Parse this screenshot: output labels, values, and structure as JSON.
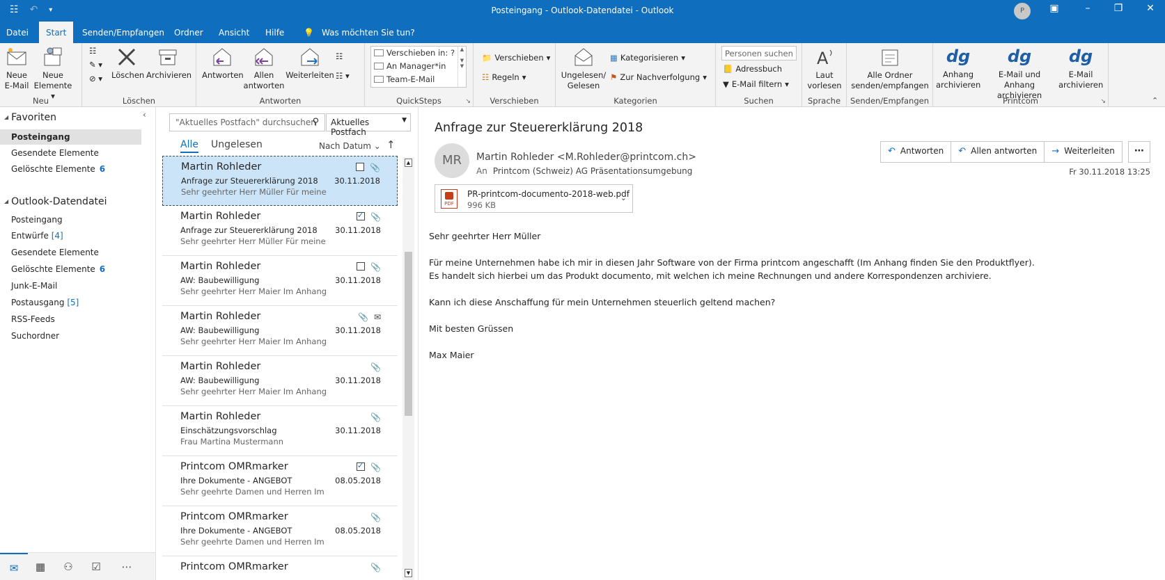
{
  "window": {
    "title": "Posteingang - Outlook-Datendatei  -  Outlook",
    "avatar_initial": "P"
  },
  "menu": {
    "tabs": [
      "Datei",
      "Start",
      "Senden/Empfangen",
      "Ordner",
      "Ansicht",
      "Hilfe"
    ],
    "active_tab": "Start",
    "tell_me": "Was möchten Sie tun?"
  },
  "ribbon": {
    "neu": {
      "label": "Neu",
      "new_email_1": "Neue",
      "new_email_2": "E-Mail",
      "new_items_1": "Neue",
      "new_items_2": "Elemente"
    },
    "loeschen": {
      "label": "Löschen",
      "delete": "Löschen",
      "archive": "Archivieren"
    },
    "antworten": {
      "label": "Antworten",
      "reply": "Antworten",
      "reply_all_1": "Allen",
      "reply_all_2": "antworten",
      "forward": "Weiterleiten"
    },
    "quicksteps": {
      "label": "QuickSteps",
      "items": [
        "Verschieben in: ?",
        "An Manager*in",
        "Team-E-Mail"
      ]
    },
    "verschieben": {
      "label": "Verschieben",
      "move": "Verschieben",
      "rules": "Regeln"
    },
    "kategorien": {
      "label": "Kategorien",
      "unread_1": "Ungelesen/",
      "unread_2": "Gelesen",
      "categorize": "Kategorisieren",
      "followup": "Zur Nachverfolgung"
    },
    "suchen": {
      "label": "Suchen",
      "people_placeholder": "Personen suchen",
      "addressbook": "Adressbuch",
      "filter": "E-Mail filtern"
    },
    "sprache": {
      "label": "Sprache",
      "read_aloud_1": "Laut",
      "read_aloud_2": "vorlesen"
    },
    "sendrecv": {
      "label": "Senden/Empfangen",
      "all_1": "Alle Ordner",
      "all_2": "senden/empfangen"
    },
    "printcom": {
      "label": "Printcom",
      "logo": "dg",
      "b1_1": "Anhang",
      "b1_2": "archivieren",
      "b2_1": "E-Mail und",
      "b2_2": "Anhang archivieren",
      "b3_1": "E-Mail",
      "b3_2": "archivieren"
    }
  },
  "folders": {
    "favorites_title": "Favoriten",
    "favorites": [
      {
        "name": "Posteingang",
        "count": ""
      },
      {
        "name": "Gesendete Elemente",
        "count": ""
      },
      {
        "name": "Gelöschte Elemente",
        "count": "6"
      }
    ],
    "datafile_title": "Outlook-Datendatei",
    "datafile": [
      {
        "name": "Posteingang",
        "count": ""
      },
      {
        "name": "Entwürfe",
        "bracket": "[4]"
      },
      {
        "name": "Gesendete Elemente",
        "count": ""
      },
      {
        "name": "Gelöschte Elemente",
        "count": "6"
      },
      {
        "name": "Junk-E-Mail",
        "count": ""
      },
      {
        "name": "Postausgang",
        "bracket": "[5]"
      },
      {
        "name": "RSS-Feeds",
        "count": ""
      },
      {
        "name": "Suchordner",
        "count": ""
      }
    ]
  },
  "list": {
    "search_placeholder": "\"Aktuelles Postfach\" durchsuchen",
    "scope": "Aktuelles Postfach",
    "filter_all": "Alle",
    "filter_unread": "Ungelesen",
    "sort": "Nach Datum",
    "messages": [
      {
        "from": "Martin Rohleder",
        "subject": "Anfrage zur Steuererklärung 2018",
        "preview": "Sehr geehrter Herr Müller  Für meine",
        "date": "30.11.2018"
      },
      {
        "from": "Martin Rohleder",
        "subject": "Anfrage zur Steuererklärung 2018",
        "preview": "Sehr geehrter Herr Müller  Für meine",
        "date": "30.11.2018"
      },
      {
        "from": "Martin Rohleder",
        "subject": "AW: Baubewilligung",
        "preview": "Sehr geehrter Herr Maier  Im Anhang",
        "date": "30.11.2018"
      },
      {
        "from": "Martin Rohleder",
        "subject": "AW: Baubewilligung",
        "preview": "Sehr geehrter Herr Maier  Im Anhang",
        "date": "30.11.2018"
      },
      {
        "from": "Martin Rohleder",
        "subject": "AW: Baubewilligung",
        "preview": "Sehr geehrter Herr Maier  Im Anhang",
        "date": "30.11.2018"
      },
      {
        "from": "Martin Rohleder",
        "subject": "Einschätzungsvorschlag",
        "preview": "Frau  Martina Mustermann",
        "date": "30.11.2018"
      },
      {
        "from": "Printcom OMRmarker",
        "subject": "Ihre Dokumente - ANGEBOT",
        "preview": "Sehr geehrte Damen und Herren  Im",
        "date": "08.05.2018"
      },
      {
        "from": "Printcom OMRmarker",
        "subject": "Ihre Dokumente - ANGEBOT",
        "preview": "Sehr geehrte Damen und Herren  Im",
        "date": "08.05.2018"
      },
      {
        "from": "Printcom OMRmarker",
        "subject": "",
        "preview": "",
        "date": ""
      }
    ]
  },
  "reading": {
    "subject": "Anfrage zur Steuererklärung 2018",
    "initials": "MR",
    "sender": "Martin Rohleder <M.Rohleder@printcom.ch>",
    "to_label": "An",
    "to": "Printcom (Schweiz) AG Präsentationsumgebung",
    "reply": "Antworten",
    "reply_all": "Allen antworten",
    "forward": "Weiterleiten",
    "sent": "Fr 30.11.2018 13:25",
    "attachment_name": "PR-printcom-documento-2018-web.pdf",
    "attachment_size": "996 KB",
    "pdf_label": "PDF",
    "body": {
      "greeting": "Sehr geehrter Herr Müller",
      "p1": "Für meine Unternehmen habe ich mir in diesen Jahr Software von der Firma printcom angeschafft (Im Anhang finden Sie den Produktflyer).",
      "p2": "Es handelt sich hierbei um das Produkt documento, mit welchen ich meine Rechnungen und andere Korrespondenzen archiviere.",
      "p3": "Kann ich diese Anschaffung für mein Unternehmen steuerlich geltend machen?",
      "closing": "Mit besten Grüssen",
      "signature": "Max Maier"
    }
  }
}
